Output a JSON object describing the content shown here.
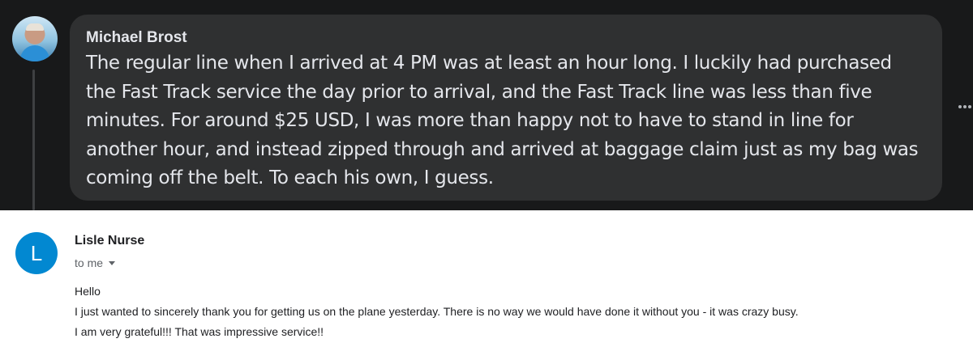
{
  "comment": {
    "author": "Michael Brost",
    "text": "The regular line when I arrived at 4 PM was at least an hour long. I luckily had purchased the Fast Track service the day prior to arrival, and the Fast Track line was less than five minutes. For around $25 USD, I was more than happy not to have to stand in line for another hour, and instead zipped through and arrived at baggage claim just as my bag was coming off the belt. To each his own, I guess.",
    "more_icon": "more-horizontal-icon"
  },
  "email": {
    "avatar_letter": "L",
    "avatar_color": "#0288d1",
    "sender": "Lisle Nurse",
    "recipient_label": "to me",
    "body_lines": [
      "Hello",
      "I just wanted to sincerely thank you for getting us on the plane yesterday. There is no way we would have done it without you - it was crazy busy.",
      "I am very grateful!!! That was impressive service!!"
    ]
  }
}
